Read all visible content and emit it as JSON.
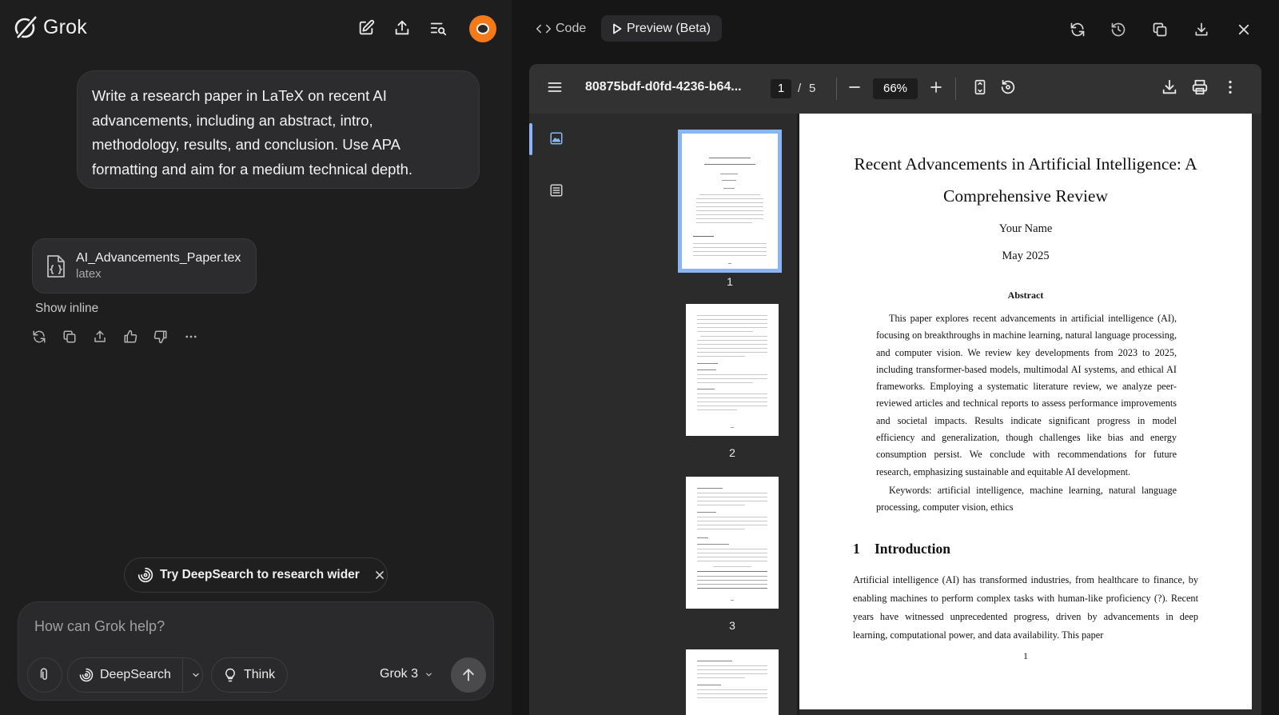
{
  "app": {
    "name": "Grok",
    "accent": "#f27a1a"
  },
  "chat": {
    "user_message": "Write a research paper in LaTeX on recent AI advancements, including an abstract, intro, methodology, results, and conclusion. Use APA formatting and aim for a medium technical depth.",
    "attachment": {
      "name": "AI_Advancements_Paper.tex",
      "type": "latex",
      "icon": "code-file-icon"
    },
    "show_inline": "Show inline",
    "actions": [
      "refresh-icon",
      "copy-icon",
      "share-icon",
      "thumbs-up-icon",
      "thumbs-down-icon",
      "more-icon"
    ]
  },
  "deepsearch_banner": {
    "label": "Try DeepSearch to research wider"
  },
  "composer": {
    "placeholder": "How can Grok help?",
    "deepsearch_label": "DeepSearch",
    "think_label": "Think",
    "model": "Grok 3"
  },
  "preview": {
    "tab_code": "Code",
    "tab_preview": "Preview (Beta)"
  },
  "pdf_viewer": {
    "filename": "80875bdf-d0fd-4236-b64...",
    "current_page": "1",
    "page_separator": "/",
    "total_pages": "5",
    "zoom": "66%",
    "thumbnails": [
      "1",
      "2",
      "3"
    ]
  },
  "document": {
    "title": "Recent Advancements in Artificial Intelligence: A Comprehensive Review",
    "author": "Your Name",
    "date": "May 2025",
    "abstract_heading": "Abstract",
    "abstract": "This paper explores recent advancements in artificial intelligence (AI), focusing on breakthroughs in machine learning, natural language processing, and computer vision. We review key developments from 2023 to 2025, including transformer-based models, multimodal AI systems, and ethical AI frameworks. Employing a systematic literature review, we analyze peer-reviewed articles and technical reports to assess performance improvements and societal impacts. Results indicate significant progress in model efficiency and generalization, though challenges like bias and energy consumption persist. We conclude with recommendations for future research, emphasizing sustainable and equitable AI development.",
    "keywords": "Keywords: artificial intelligence, machine learning, natural language processing, computer vision, ethics",
    "section_number": "1",
    "section_title": "Introduction",
    "intro": "Artificial intelligence (AI) has transformed industries, from healthcare to finance, by enabling machines to perform complex tasks with human-like proficiency (?). Recent years have witnessed unprecedented progress, driven by advancements in deep learning, computational power, and data availability. This paper",
    "page_number": "1"
  }
}
